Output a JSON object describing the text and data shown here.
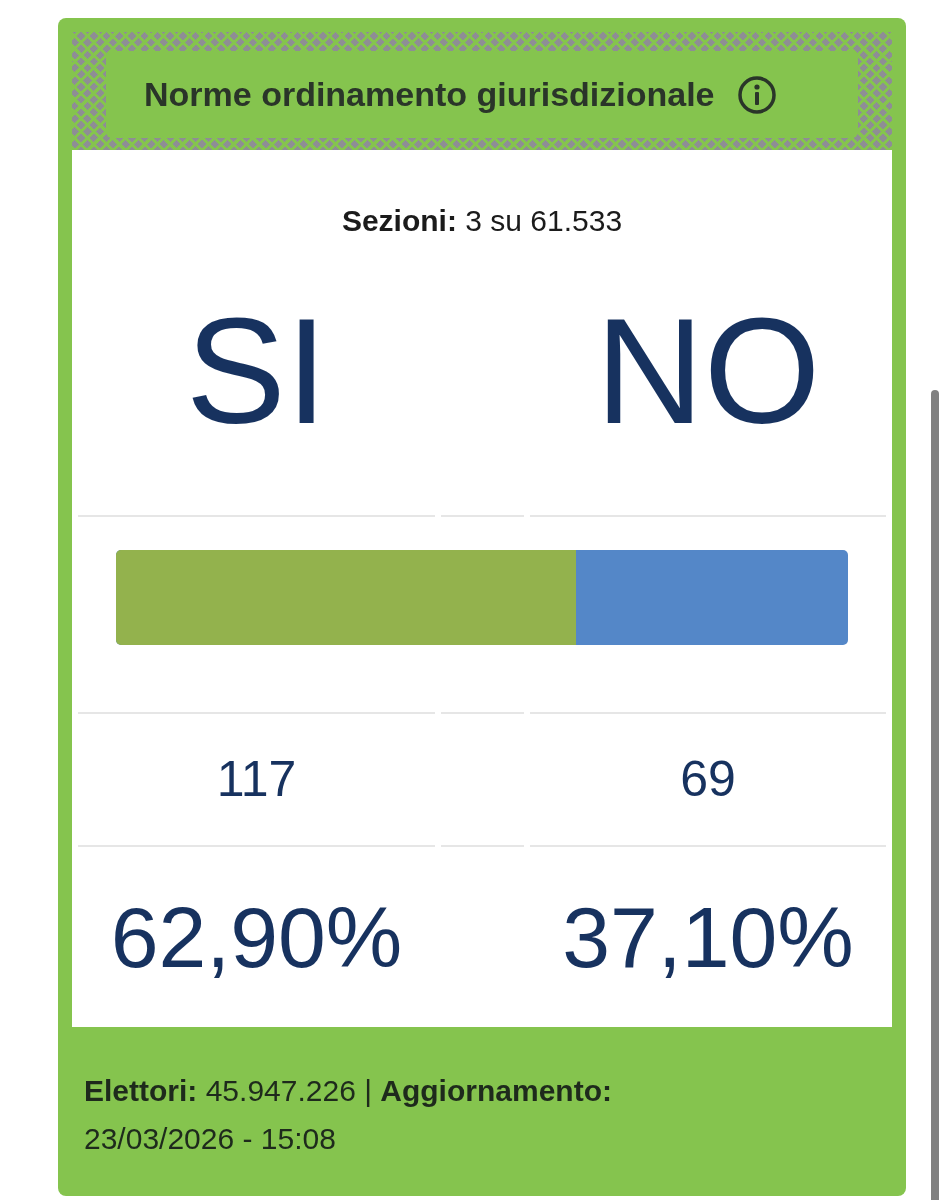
{
  "title": "Norme ordinamento giurisdizionale",
  "sections": "**Sezioni:** 3 su 61.533",
  "options": [
    {
      "label": "SI",
      "votes": "117",
      "percent": "62,90%",
      "color": "#93b24d"
    },
    {
      "label": "NO",
      "votes": "69",
      "percent": "37,10%",
      "color": "#5487c8"
    }
  ],
  "bar": {
    "level": 0.629
  },
  "footer": "**Elettori:** 45.947.226 | **Aggiornamento:** 23/03/2026 - 15:08"
}
